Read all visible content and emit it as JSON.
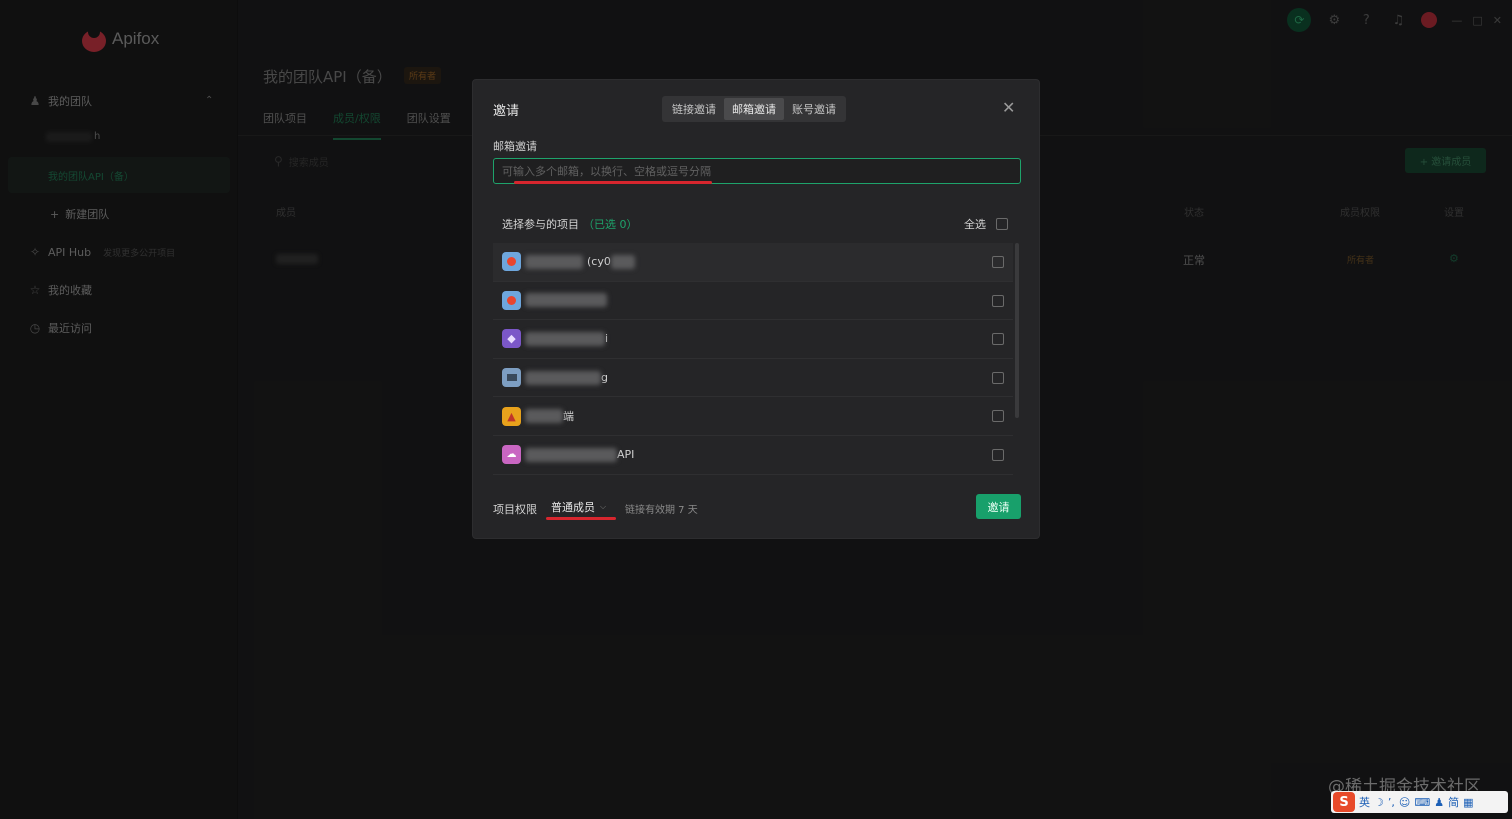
{
  "app": {
    "name": "Apifox"
  },
  "sidebar": {
    "my_team": "我的团队",
    "team_item_blurred_suffix": "h",
    "active_team": "我的团队API（备）",
    "new_team": "新建团队",
    "api_hub": "API Hub",
    "api_hub_hint": "发现更多公开项目",
    "favorites": "我的收藏",
    "recent": "最近访问"
  },
  "main": {
    "title": "我的团队API（备）",
    "owner_badge": "所有者",
    "tabs": [
      {
        "label": "团队项目"
      },
      {
        "label": "成员/权限"
      },
      {
        "label": "团队设置"
      }
    ],
    "search_placeholder": "搜索成员",
    "invite_member_button": "+ 邀请成员",
    "columns": {
      "member": "成员",
      "status": "状态",
      "permission": "成员权限",
      "settings": "设置"
    },
    "row": {
      "status": "正常",
      "permission": "所有者"
    }
  },
  "modal": {
    "title": "邀请",
    "segments": [
      {
        "label": "链接邀请",
        "active": false
      },
      {
        "label": "邮箱邀请",
        "active": true
      },
      {
        "label": "账号邀请",
        "active": false
      }
    ],
    "email_label": "邮箱邀请",
    "email_placeholder": "可输入多个邮箱，以换行、空格或逗号分隔",
    "projects_label": "选择参与的项目",
    "selected_count": "（已选 0）",
    "select_all": "全选",
    "projects": [
      {
        "suffix": "(cy0",
        "icon_color": "#6ea6dd",
        "icon": "planet-icon"
      },
      {
        "suffix": "",
        "icon_color": "#6ea6dd",
        "icon": "planet-icon"
      },
      {
        "suffix": "i",
        "icon_color": "#7b57c8",
        "icon": "kite-icon"
      },
      {
        "suffix": "g",
        "icon_color": "#7d9ec2",
        "icon": "box-icon"
      },
      {
        "suffix": "端",
        "icon_color": "#e8a21c",
        "icon": "mountain-icon"
      },
      {
        "suffix": "API",
        "icon_color": "#c966c2",
        "icon": "cloud-icon"
      }
    ],
    "permission_label": "项目权限",
    "permission_value": "普通成员",
    "expiry_text": "链接有效期 7 天",
    "invite_button": "邀请"
  },
  "overlay_text": {
    "watermark": "@稀土掘金技术社区",
    "ime_items": [
      "英",
      "简"
    ]
  },
  "colors": {
    "accent": "#1ea36b",
    "annotation_red": "#d7262e"
  }
}
